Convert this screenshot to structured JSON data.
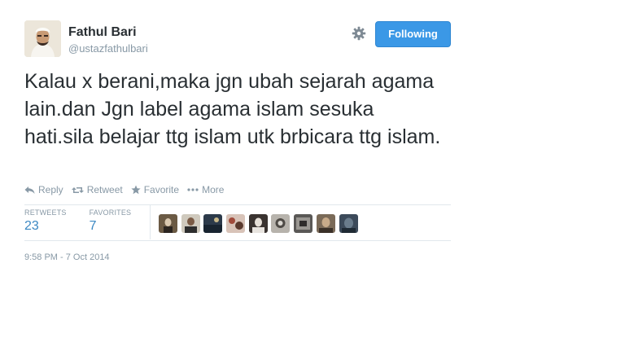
{
  "author": {
    "name": "Fathul Bari",
    "handle": "@ustazfathulbari",
    "follow_label": "Following"
  },
  "tweet": {
    "text": "Kalau x berani,maka jgn ubah sejarah agama lain.dan Jgn label agama islam sesuka hati.sila belajar ttg islam utk brbicara ttg islam."
  },
  "actions": {
    "reply": "Reply",
    "retweet": "Retweet",
    "favorite": "Favorite",
    "more": "More"
  },
  "stats": {
    "retweets_label": "RETWEETS",
    "retweets_count": "23",
    "favorites_label": "FAVORITES",
    "favorites_count": "7"
  },
  "timestamp": "9:58 PM - 7 Oct 2014",
  "icons": {
    "settings": "gear-icon",
    "reply": "reply-arrow-icon",
    "retweet": "retweet-icon",
    "favorite": "star-icon",
    "more": "ellipsis-icon"
  },
  "colors": {
    "follow_button": "#3b98e6",
    "stat_value": "#3b88c3",
    "muted_text": "#8899a6"
  }
}
